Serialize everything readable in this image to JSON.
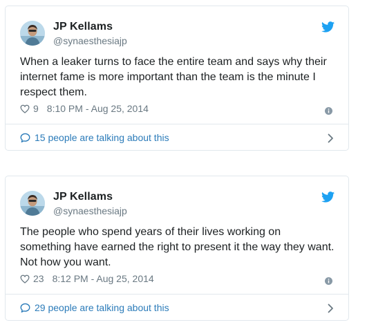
{
  "colors": {
    "link": "#2b7bb9",
    "twitter_blue": "#1da1f2",
    "meta_gray": "#697882",
    "border": "#e1e8ed"
  },
  "tweets": [
    {
      "author_name": "JP Kellams",
      "handle": "@synaesthesiajp",
      "text": "When a leaker turns to face the entire team and says why their internet fame is more important than the team is the minute I respect them.",
      "likes": "9",
      "timestamp": "8:10 PM - Aug 25, 2014",
      "talking": "15 people are talking about this"
    },
    {
      "author_name": "JP Kellams",
      "handle": "@synaesthesiajp",
      "text": "The people who spend years of their lives working on something have earned the right to present it the way they want. Not how you want.",
      "likes": "23",
      "timestamp": "8:12 PM - Aug 25, 2014",
      "talking": "29 people are talking about this"
    }
  ],
  "icons": {
    "brand": "twitter-bird-icon",
    "like": "heart-icon",
    "info": "info-icon",
    "conversation": "speech-bubble-icon",
    "more": "chevron-right-icon"
  }
}
